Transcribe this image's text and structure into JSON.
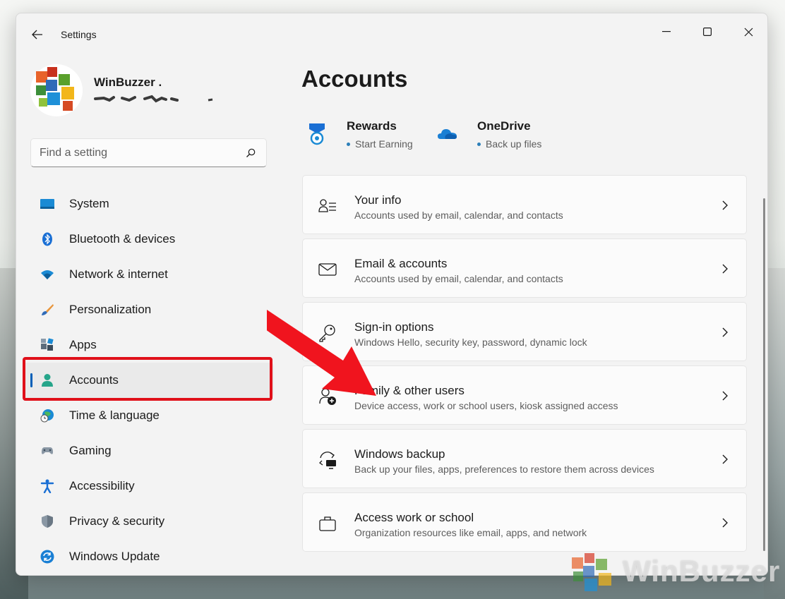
{
  "window": {
    "title": "Settings"
  },
  "profile": {
    "name": "WinBuzzer ."
  },
  "search": {
    "placeholder": "Find a setting"
  },
  "nav": {
    "items": [
      {
        "label": "System"
      },
      {
        "label": "Bluetooth & devices"
      },
      {
        "label": "Network & internet"
      },
      {
        "label": "Personalization"
      },
      {
        "label": "Apps"
      },
      {
        "label": "Accounts"
      },
      {
        "label": "Time & language"
      },
      {
        "label": "Gaming"
      },
      {
        "label": "Accessibility"
      },
      {
        "label": "Privacy & security"
      },
      {
        "label": "Windows Update"
      }
    ],
    "selected": "Accounts"
  },
  "main": {
    "title": "Accounts",
    "promos": [
      {
        "title": "Rewards",
        "subtitle": "Start Earning"
      },
      {
        "title": "OneDrive",
        "subtitle": "Back up files"
      }
    ],
    "cards": [
      {
        "title": "Your info",
        "subtitle": "Accounts used by email, calendar, and contacts"
      },
      {
        "title": "Email & accounts",
        "subtitle": "Accounts used by email, calendar, and contacts"
      },
      {
        "title": "Sign-in options",
        "subtitle": "Windows Hello, security key, password, dynamic lock"
      },
      {
        "title": "Family & other users",
        "subtitle": "Device access, work or school users, kiosk assigned access"
      },
      {
        "title": "Windows backup",
        "subtitle": "Back up your files, apps, preferences to restore them across devices"
      },
      {
        "title": "Access work or school",
        "subtitle": "Organization resources like email, apps, and network"
      }
    ]
  },
  "watermark": {
    "text": "WinBuzzer"
  },
  "colors": {
    "accent": "#005fb8",
    "highlight": "#e0101a",
    "arrow": "#f0141e"
  }
}
